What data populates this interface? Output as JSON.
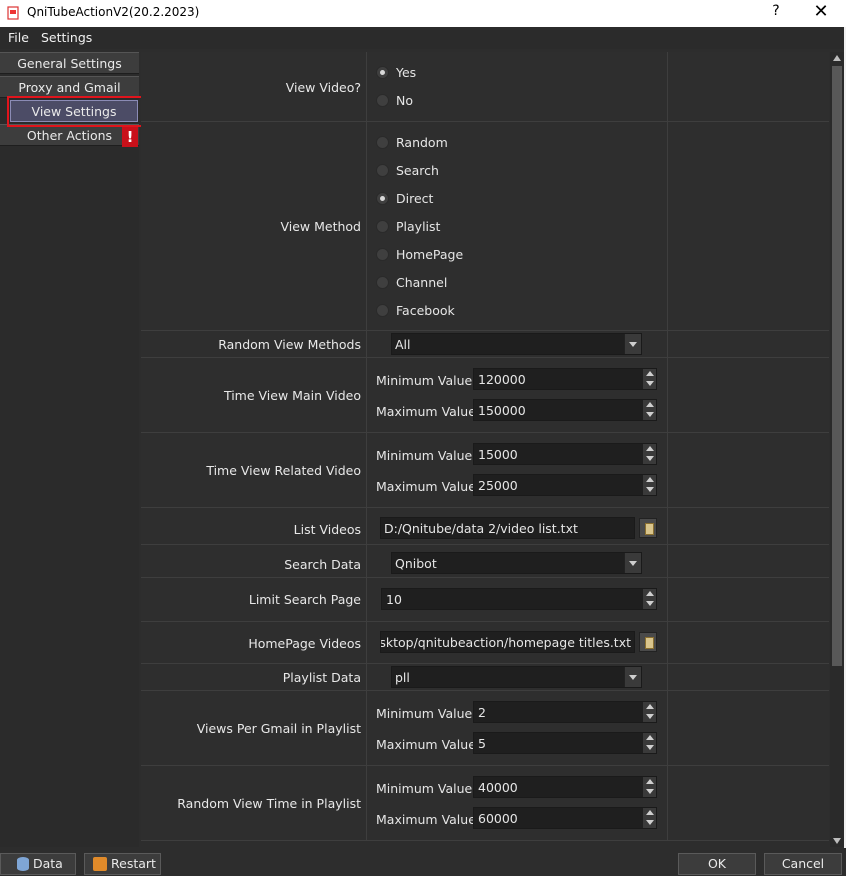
{
  "window": {
    "title": "QniTubeActionV2(20.2.2023)",
    "help": "?",
    "close": "✕"
  },
  "menu": [
    "File",
    "Settings"
  ],
  "sidebar": {
    "items": [
      {
        "label": "General Settings"
      },
      {
        "label": "Proxy and Gmail"
      },
      {
        "label": "View Settings"
      },
      {
        "label": "Other Actions"
      }
    ],
    "warning": "!"
  },
  "settings": {
    "view_video": {
      "label": "View Video?",
      "options": [
        "Yes",
        "No"
      ],
      "selected": "Yes"
    },
    "view_method": {
      "label": "View Method",
      "options": [
        "Random",
        "Search",
        "Direct",
        "Playlist",
        "HomePage",
        "Channel",
        "Facebook"
      ],
      "selected": "Direct"
    },
    "random_view_methods": {
      "label": "Random View Methods",
      "value": "All"
    },
    "time_view_main": {
      "label": "Time View Main Video",
      "min_label": "Minimum Value",
      "min": "120000",
      "max_label": "Maximum Value",
      "max": "150000"
    },
    "time_view_related": {
      "label": "Time View Related Video",
      "min_label": "Minimum Value",
      "min": "15000",
      "max_label": "Maximum Value",
      "max": "25000"
    },
    "list_videos": {
      "label": "List Videos",
      "value": "D:/Qnitube/data 2/video list.txt"
    },
    "search_data": {
      "label": "Search Data",
      "value": "Qnibot"
    },
    "limit_search_page": {
      "label": "Limit Search Page",
      "value": "10"
    },
    "homepage_videos": {
      "label": "HomePage Videos",
      "value": "?/Desktop/qnitubeaction/homepage titles.txt"
    },
    "playlist_data": {
      "label": "Playlist Data",
      "value": "pll"
    },
    "views_per_gmail": {
      "label": "Views Per Gmail in Playlist",
      "min_label": "Minimum Value",
      "min": "2",
      "max_label": "Maximum Value",
      "max": "5"
    },
    "random_view_time": {
      "label": "Random View Time in Playlist",
      "min_label": "Minimum Value",
      "min": "40000",
      "max_label": "Maximum Value",
      "max": "60000"
    }
  },
  "bottom": {
    "data": "Data",
    "restart": "Restart",
    "ok": "OK",
    "cancel": "Cancel"
  }
}
